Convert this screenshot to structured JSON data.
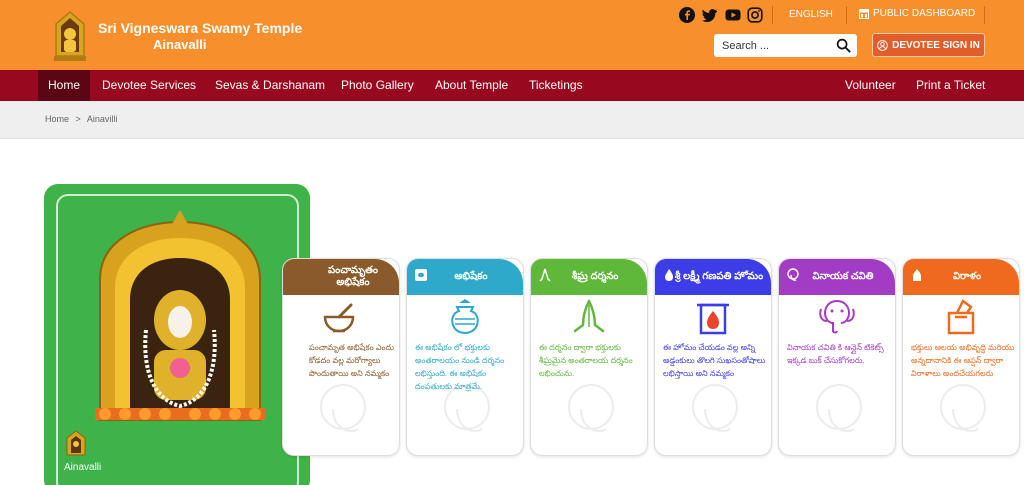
{
  "header": {
    "title": "Sri Vigneswara Swamy Temple",
    "subtitle": "Ainavalli",
    "language_label": "ENGLISH",
    "dashboard_label": "PUBLIC DASHBOARD",
    "search_placeholder": "Search ...",
    "signin_label": "DEVOTEE SIGN IN",
    "social": [
      "facebook-icon",
      "twitter-icon",
      "youtube-icon",
      "instagram-icon"
    ]
  },
  "nav": {
    "items": [
      "Home",
      "Devotee Services",
      "Sevas & Darshanam",
      "Photo Gallery",
      "About Temple",
      "Ticketings",
      "Volunteer",
      "Print a Ticket"
    ],
    "active": "Home"
  },
  "breadcrumb": {
    "home": "Home",
    "separator": ">",
    "current": "Ainavilli"
  },
  "hero": {
    "label": "Ainavalli"
  },
  "cards": [
    {
      "title": "పంచామృతం అభిషేకం",
      "text": "పంచామృత అభిషేకం ఎందు కోడదం వల్ల మరోగ్యాలు పొందుతాయి అని నమ్మకం",
      "color": "#8b5a2b",
      "icon": "mortar-pestle-icon"
    },
    {
      "title": "అభిషేకం",
      "text": "ఈ అభిషేకం లో భక్తులకు అంతరాలయం నుండి దర్శనం లభిస్తుంది. ఈ అభిషేకం దంపతులకు మాత్రమే.",
      "color": "#2fa9c9",
      "icon": "kalash-icon"
    },
    {
      "title": "శీఘ్ర దర్శనం",
      "text": "ఈ దర్శనం ద్వారా భక్తులకు శీఘ్రమైన అంతరాలయ దర్శనం లభించును.",
      "color": "#5fb83a",
      "icon": "namaste-icon"
    },
    {
      "title": "శ్రీ లక్ష్మీ గణపతి హోమం",
      "text": "ఈ హోమం చేయడం వల్ల అన్ని అడ్డంకులు తొలగి సుఖసంతోషాలు లభిస్తాయి అని నమ్మకం",
      "color": "#3d3de8",
      "icon": "fire-icon"
    },
    {
      "title": "వినాయక చవితి",
      "text": "వినాయక చవితి కి ఆన్లైన్ టికెట్స్ ఇక్కడ బుక్ చేసుకోగలరు.",
      "color": "#a33cc4",
      "icon": "ganesha-icon"
    },
    {
      "title": "విరాళం",
      "text": "భక్తులు ఆలయ అభివృద్ధి మరియు అన్నదానానికి ఈ ఆప్షన్ ద్వారా విరాళాలు అందచేయగలరు",
      "color": "#ef6a1f",
      "icon": "donation-box-icon"
    }
  ],
  "colors": {
    "header_bg": "#f7902c",
    "nav_bg": "#98091f",
    "nav_active_bg": "#5b0612",
    "signin_bg": "#e25d2c",
    "hero_bg": "#3db34a"
  }
}
